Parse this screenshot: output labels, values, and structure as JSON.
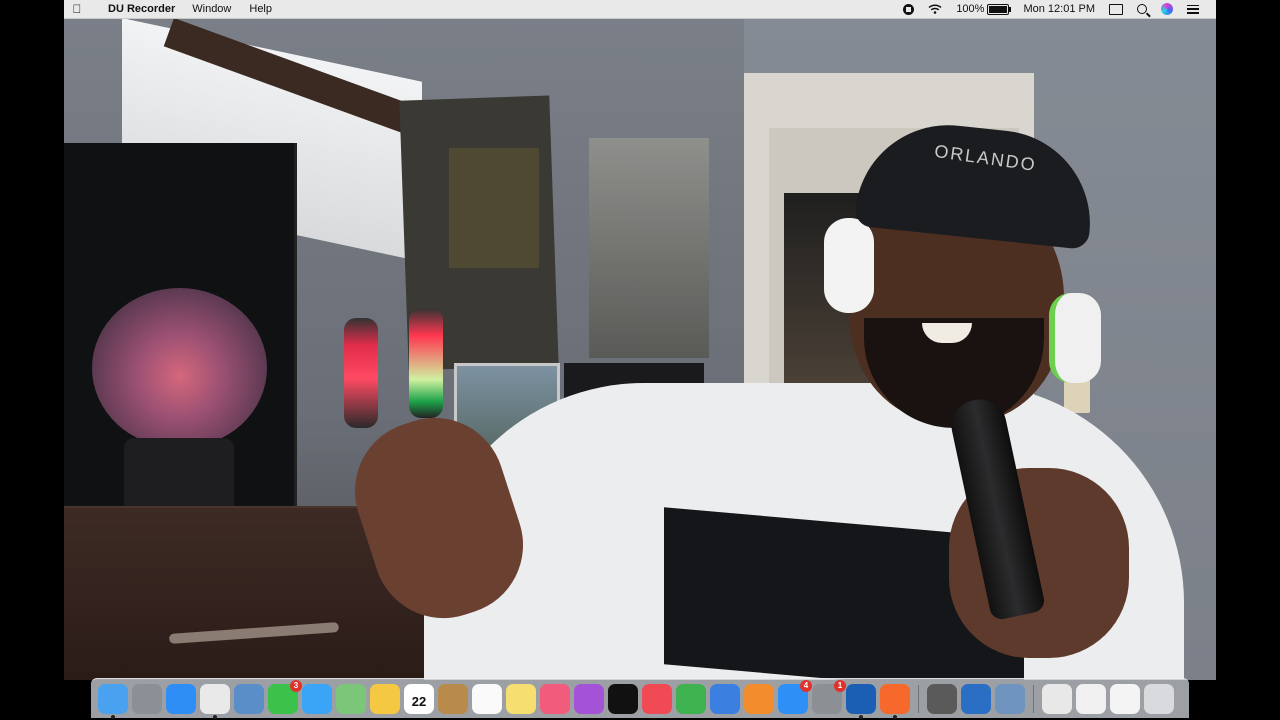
{
  "menubar": {
    "app_name": "DU Recorder",
    "menus": [
      "Window",
      "Help"
    ],
    "battery_percent": "100%",
    "clock": "Mon 12:01 PM"
  },
  "scene": {
    "cap_text": "ORLANDO"
  },
  "dock": {
    "apps": [
      {
        "name": "Finder",
        "icon": "finder-icon",
        "color": "#4aa1f0",
        "running": true
      },
      {
        "name": "Launchpad",
        "icon": "launchpad-icon",
        "color": "#8b8f96"
      },
      {
        "name": "Safari",
        "icon": "safari-icon",
        "color": "#2f8ef5"
      },
      {
        "name": "Chrome",
        "icon": "chrome-icon",
        "color": "#e9e9e9",
        "running": true
      },
      {
        "name": "Preview",
        "icon": "preview-icon",
        "color": "#5a8ec9"
      },
      {
        "name": "FaceTime",
        "icon": "facetime-icon",
        "color": "#3bc24b",
        "badge": "3"
      },
      {
        "name": "Messages",
        "icon": "messages-icon",
        "color": "#3aa5f6"
      },
      {
        "name": "Maps",
        "icon": "maps-icon",
        "color": "#7cc67a"
      },
      {
        "name": "Photos",
        "icon": "photos-icon",
        "color": "#f4c842"
      },
      {
        "name": "Calendar",
        "icon": "calendar-icon",
        "color": "#ffffff",
        "day": "22"
      },
      {
        "name": "Notes Book",
        "icon": "book-icon",
        "color": "#b88a4c"
      },
      {
        "name": "Reminders",
        "icon": "reminders-icon",
        "color": "#fafafa"
      },
      {
        "name": "Notes",
        "icon": "notes-icon",
        "color": "#f6de70"
      },
      {
        "name": "Music",
        "icon": "music-icon",
        "color": "#f15b7c"
      },
      {
        "name": "Podcasts",
        "icon": "podcasts-icon",
        "color": "#a453d6"
      },
      {
        "name": "TV",
        "icon": "tv-icon",
        "color": "#111111"
      },
      {
        "name": "News",
        "icon": "news-icon",
        "color": "#f04a55"
      },
      {
        "name": "Numbers",
        "icon": "numbers-icon",
        "color": "#3eb24f"
      },
      {
        "name": "Keynote",
        "icon": "keynote-icon",
        "color": "#3b7fe0"
      },
      {
        "name": "Pages",
        "icon": "pages-icon",
        "color": "#f28c2c"
      },
      {
        "name": "App Store",
        "icon": "appstore-icon",
        "color": "#2e8ff6",
        "badge": "4"
      },
      {
        "name": "System Preferences",
        "icon": "system-preferences-icon",
        "color": "#8c8f94",
        "badge": "1"
      },
      {
        "name": "QuickTime",
        "icon": "quicktime-icon",
        "color": "#1b5fb5",
        "running": true
      },
      {
        "name": "DU Recorder",
        "icon": "du-recorder-icon",
        "color": "#f6682b",
        "running": true
      }
    ],
    "docs": [
      {
        "name": "Calculator",
        "icon": "calculator-icon",
        "color": "#5a5a5a"
      },
      {
        "name": "Xcode",
        "icon": "xcode-icon",
        "color": "#2b6fc5"
      },
      {
        "name": "Screen",
        "icon": "screenshot-icon",
        "color": "#6f93bf"
      }
    ],
    "stacks": [
      {
        "name": "Downloads",
        "icon": "downloads-stack-icon",
        "color": "#e8e8e8"
      },
      {
        "name": "Documents",
        "icon": "documents-stack-icon",
        "color": "#f0f0f0"
      },
      {
        "name": "Files",
        "icon": "files-stack-icon",
        "color": "#f4f4f4"
      },
      {
        "name": "Trash",
        "icon": "trash-icon",
        "color": "#d8dadd"
      }
    ]
  }
}
